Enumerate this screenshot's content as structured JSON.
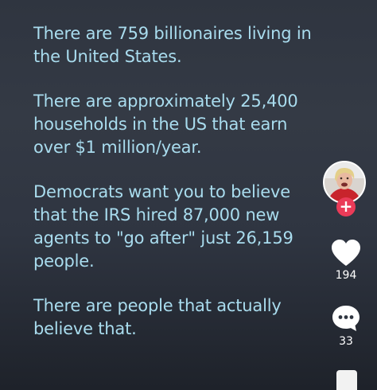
{
  "post": {
    "paragraphs": [
      "There are 759 billionaires living in the United States.",
      "There are approximately 25,400 households in the US that earn over $1 million/year.",
      "Democrats want you to believe that the IRS hired 87,000 new agents to \"go after\" just 26,159 people.",
      "There are people that actually believe that."
    ]
  },
  "actions": {
    "follow_symbol": "+",
    "like_count": "194",
    "comment_count": "33"
  },
  "colors": {
    "text": "#a9dcee",
    "follow": "#ea3b58",
    "icons": "#ffffff"
  },
  "icons": [
    "heart-icon",
    "comment-bubble-icon",
    "bookmark-icon",
    "plus-icon"
  ]
}
